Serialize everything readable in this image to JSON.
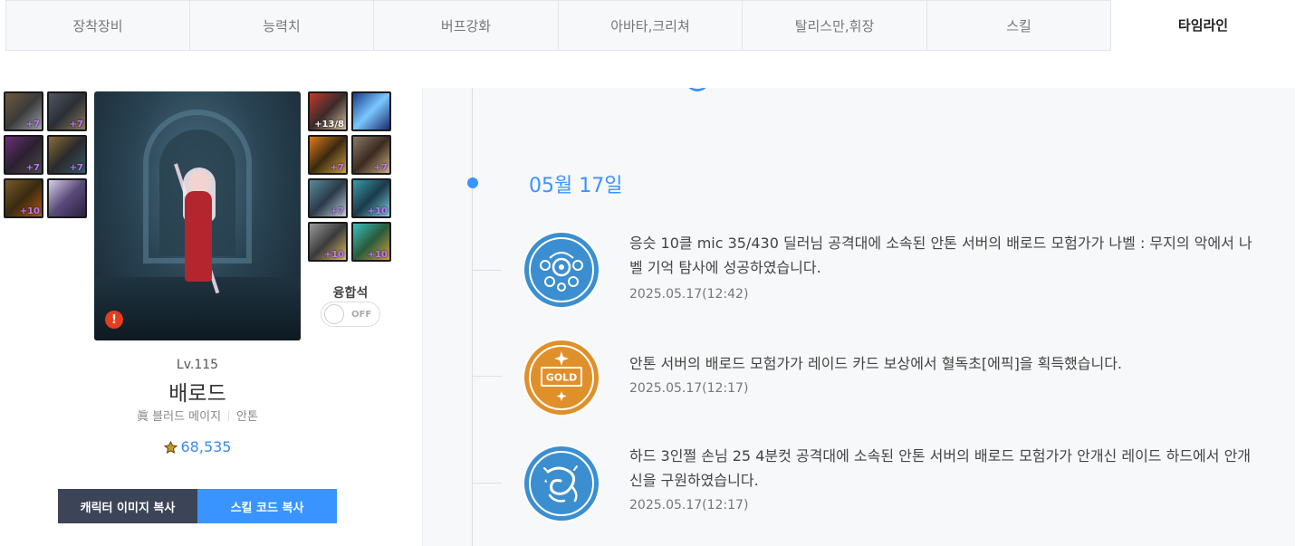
{
  "tabs": [
    {
      "label": "장착장비",
      "active": false
    },
    {
      "label": "능력치",
      "active": false
    },
    {
      "label": "버프강화",
      "active": false
    },
    {
      "label": "아바타,크리쳐",
      "active": false
    },
    {
      "label": "탈리스만,휘장",
      "active": false
    },
    {
      "label": "스킬",
      "active": false
    },
    {
      "label": "타임라인",
      "active": true
    }
  ],
  "character": {
    "level": "Lv.115",
    "name": "배로드",
    "job": "眞 블러드 메이지",
    "server": "안톤",
    "fame": "68,535",
    "fusion_label": "융합석",
    "fusion_toggle": "OFF",
    "alert_icon": "!",
    "left_slots": [
      "+7",
      "+7",
      "+7",
      "+7",
      "+10",
      ""
    ],
    "right_slots": [
      "+13/8",
      "",
      "+7",
      "+7",
      "+7",
      "+10",
      "+10",
      "+10"
    ]
  },
  "buttons": {
    "copy_image": "캐릭터 이미지 복사",
    "copy_skill": "스킬 코드 복사"
  },
  "timeline": {
    "date": "05월 17일",
    "entries": [
      {
        "icon": "raid-emblem-icon",
        "text": "응슷 10클 mic 35/430 딜러님 공격대에 소속된 안톤 서버의 배로드 모험가가 나벨 : 무지의 악에서 나벨 기억 탐사에 성공하였습니다.",
        "time": "2025.05.17(12:42)"
      },
      {
        "icon": "gold-card-icon",
        "badge_text": "GOLD",
        "text": "안톤 서버의 배로드 모험가가 레이드 카드 보상에서 혈독초[에픽]을 획득했습니다.",
        "time": "2025.05.17(12:17)"
      },
      {
        "icon": "dragon-emblem-icon",
        "text": "하드 3인쩔 손님 25 4분컷 공격대에 소속된 안톤 서버의 배로드 모험가가 안개신 레이드 하드에서 안개신을 구원하였습니다.",
        "time": "2025.05.17(12:17)"
      }
    ]
  },
  "colors": {
    "accent": "#3994ff",
    "gold": "#e0902a",
    "dark_button": "#3c4457"
  }
}
